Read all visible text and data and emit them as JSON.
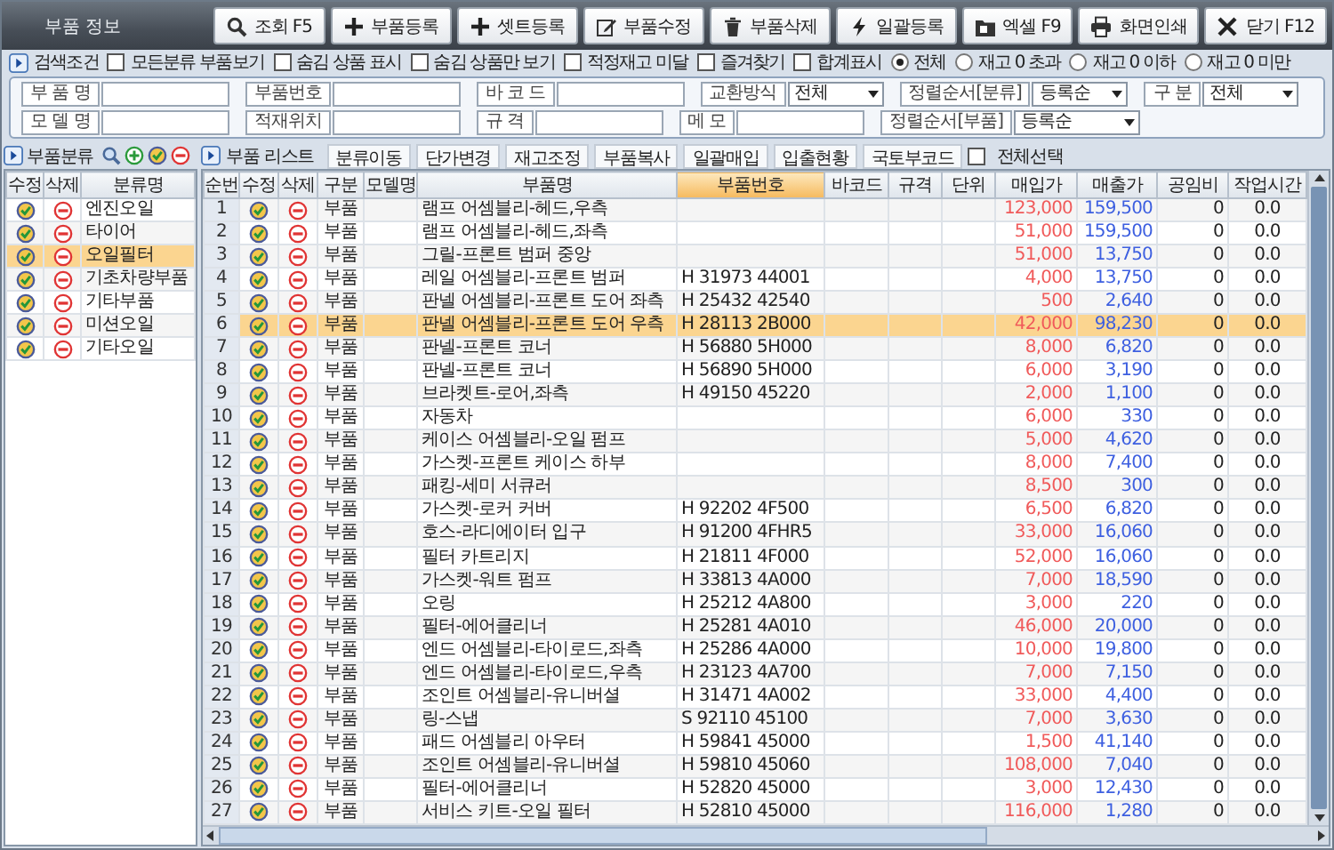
{
  "window": {
    "title": "부품 정보"
  },
  "toolbar": [
    {
      "kind": "search",
      "label": "조회 F5"
    },
    {
      "kind": "add",
      "label": "부품등록"
    },
    {
      "kind": "add",
      "label": "셋트등록"
    },
    {
      "kind": "edit",
      "label": "부품수정"
    },
    {
      "kind": "delete",
      "label": "부품삭제"
    },
    {
      "kind": "bolt",
      "label": "일괄등록"
    },
    {
      "kind": "excel",
      "label": "엑셀 F9"
    },
    {
      "kind": "print",
      "label": "화면인쇄"
    },
    {
      "kind": "close",
      "label": "닫기 F12"
    }
  ],
  "search_options": {
    "title": "검색조건",
    "checkboxes": [
      {
        "label": "모든분류 부품보기",
        "checked": false
      },
      {
        "label": "숨김 상품 표시",
        "checked": false
      },
      {
        "label": "숨김 상품만 보기",
        "checked": false
      },
      {
        "label": "적정재고 미달",
        "checked": false
      },
      {
        "label": "즐겨찾기",
        "checked": false
      },
      {
        "label": "합계표시",
        "checked": false
      }
    ],
    "radios": [
      {
        "label": "전체",
        "selected": true
      },
      {
        "label": "재고 0 초과",
        "selected": false
      },
      {
        "label": "재고 0 이하",
        "selected": false
      },
      {
        "label": "재고 0 미만",
        "selected": false
      }
    ]
  },
  "filters": [
    [
      {
        "kind": "text",
        "label": "부 품 명"
      },
      {
        "kind": "text",
        "label": "부품번호"
      },
      {
        "kind": "text",
        "label": "바 코 드"
      },
      {
        "kind": "select",
        "label": "교환방식",
        "value": "전체"
      },
      {
        "kind": "select",
        "label": "정렬순서[분류]",
        "value": "등록순"
      },
      {
        "kind": "select",
        "label": "구 분",
        "value": "전체"
      }
    ],
    [
      {
        "kind": "text",
        "label": "모 델 명"
      },
      {
        "kind": "text",
        "label": "적재위치"
      },
      {
        "kind": "text",
        "label": "규 격"
      },
      {
        "kind": "text",
        "label": "메 모"
      },
      {
        "kind": "select",
        "label": "정렬순서[부품]",
        "value": "등록순"
      }
    ]
  ],
  "category_panel": {
    "title": "부품분류",
    "columns": [
      "수정",
      "삭제",
      "분류명"
    ],
    "rows": [
      {
        "name": "엔진오일",
        "selected": false
      },
      {
        "name": "타이어",
        "selected": false
      },
      {
        "name": "오일필터",
        "selected": true
      },
      {
        "name": "기초차량부품",
        "selected": false
      },
      {
        "name": "기타부품",
        "selected": false
      },
      {
        "name": "미션오일",
        "selected": false
      },
      {
        "name": "기타오일",
        "selected": false
      }
    ]
  },
  "parts_panel": {
    "title": "부품 리스트",
    "actions": [
      "분류이동",
      "단가변경",
      "재고조정",
      "부품복사",
      "일괄매입",
      "입출현황",
      "국토부코드"
    ],
    "select_all": {
      "label": "전체선택",
      "checked": false
    },
    "columns": [
      {
        "label": "순번",
        "sorted": false
      },
      {
        "label": "수정",
        "sorted": false
      },
      {
        "label": "삭제",
        "sorted": false
      },
      {
        "label": "구분",
        "sorted": false
      },
      {
        "label": "모델명",
        "sorted": false
      },
      {
        "label": "부품명",
        "sorted": false
      },
      {
        "label": "부품번호",
        "sorted": true
      },
      {
        "label": "바코드",
        "sorted": false
      },
      {
        "label": "규격",
        "sorted": false
      },
      {
        "label": "단위",
        "sorted": false
      },
      {
        "label": "매입가",
        "sorted": false
      },
      {
        "label": "매출가",
        "sorted": false
      },
      {
        "label": "공임비",
        "sorted": false
      },
      {
        "label": "작업시간",
        "sorted": false
      }
    ],
    "rows": [
      {
        "no": "1",
        "type": "부품",
        "name": "램프 어셈블리-헤드,우측",
        "buy": "123,000",
        "sell": "159,500",
        "labor": "0",
        "time": "0.0",
        "selected": false
      },
      {
        "no": "2",
        "type": "부품",
        "name": "램프 어셈블리-헤드,좌측",
        "buy": "51,000",
        "sell": "159,500",
        "labor": "0",
        "time": "0.0",
        "selected": false
      },
      {
        "no": "3",
        "type": "부품",
        "name": "그릴-프론트 범퍼 중앙",
        "buy": "51,000",
        "sell": "13,750",
        "labor": "0",
        "time": "0.0",
        "selected": false
      },
      {
        "no": "4",
        "type": "부품",
        "name": "레일 어셈블리-프론트 범퍼",
        "part_no": "H 31973 44001",
        "buy": "4,000",
        "sell": "13,750",
        "labor": "0",
        "time": "0.0",
        "selected": false
      },
      {
        "no": "5",
        "type": "부품",
        "name": "판넬 어셈블리-프론트 도어 좌측",
        "part_no": "H 25432 42540",
        "buy": "500",
        "sell": "2,640",
        "labor": "0",
        "time": "0.0",
        "selected": false
      },
      {
        "no": "6",
        "type": "부품",
        "name": "판넬 어셈블리-프론트 도어 우측",
        "part_no": "H 28113 2B000",
        "buy": "42,000",
        "sell": "98,230",
        "labor": "0",
        "time": "0.0",
        "selected": true
      },
      {
        "no": "7",
        "type": "부품",
        "name": "판넬-프론트 코너",
        "part_no": "H 56880 5H000",
        "buy": "8,000",
        "sell": "6,820",
        "labor": "0",
        "time": "0.0",
        "selected": false
      },
      {
        "no": "8",
        "type": "부품",
        "name": "판넬-프론트 코너",
        "part_no": "H 56890 5H000",
        "buy": "6,000",
        "sell": "3,190",
        "labor": "0",
        "time": "0.0",
        "selected": false
      },
      {
        "no": "9",
        "type": "부품",
        "name": "브라켓트-로어,좌측",
        "part_no": "H 49150 45220",
        "buy": "2,000",
        "sell": "1,100",
        "labor": "0",
        "time": "0.0",
        "selected": false
      },
      {
        "no": "10",
        "type": "부품",
        "name": "자동차",
        "buy": "6,000",
        "sell": "330",
        "labor": "0",
        "time": "0.0",
        "selected": false
      },
      {
        "no": "11",
        "type": "부품",
        "name": "케이스 어셈블리-오일 펌프",
        "buy": "5,000",
        "sell": "4,620",
        "labor": "0",
        "time": "0.0",
        "selected": false
      },
      {
        "no": "12",
        "type": "부품",
        "name": "가스켓-프론트 케이스 하부",
        "buy": "8,000",
        "sell": "7,400",
        "labor": "0",
        "time": "0.0",
        "selected": false
      },
      {
        "no": "13",
        "type": "부품",
        "name": "패킹-세미 서큐러",
        "buy": "8,500",
        "sell": "300",
        "labor": "0",
        "time": "0.0",
        "selected": false
      },
      {
        "no": "14",
        "type": "부품",
        "name": "가스켓-로커 커버",
        "part_no": "H 92202 4F500",
        "buy": "6,500",
        "sell": "6,820",
        "labor": "0",
        "time": "0.0",
        "selected": false
      },
      {
        "no": "15",
        "type": "부품",
        "name": "호스-라디에이터 입구",
        "part_no": "H 91200 4FHR5",
        "buy": "33,000",
        "sell": "16,060",
        "labor": "0",
        "time": "0.0",
        "selected": false
      },
      {
        "no": "16",
        "type": "부품",
        "name": "필터 카트리지",
        "part_no": "H 21811 4F000",
        "buy": "52,000",
        "sell": "16,060",
        "labor": "0",
        "time": "0.0",
        "selected": false
      },
      {
        "no": "17",
        "type": "부품",
        "name": "가스켓-워트 펌프",
        "part_no": "H 33813 4A000",
        "buy": "7,000",
        "sell": "18,590",
        "labor": "0",
        "time": "0.0",
        "selected": false
      },
      {
        "no": "18",
        "type": "부품",
        "name": "오링",
        "part_no": "H 25212 4A800",
        "buy": "3,000",
        "sell": "220",
        "labor": "0",
        "time": "0.0",
        "selected": false
      },
      {
        "no": "19",
        "type": "부품",
        "name": "필터-에어클리너",
        "part_no": "H 25281 4A010",
        "buy": "46,000",
        "sell": "20,000",
        "labor": "0",
        "time": "0.0",
        "selected": false
      },
      {
        "no": "20",
        "type": "부품",
        "name": "엔드 어셈블리-타이로드,좌측",
        "part_no": "H 25286 4A000",
        "buy": "10,000",
        "sell": "19,800",
        "labor": "0",
        "time": "0.0",
        "selected": false
      },
      {
        "no": "21",
        "type": "부품",
        "name": "엔드 어셈블리-타이로드,우측",
        "part_no": "H 23123 4A700",
        "buy": "7,000",
        "sell": "7,150",
        "labor": "0",
        "time": "0.0",
        "selected": false
      },
      {
        "no": "22",
        "type": "부품",
        "name": "조인트 어셈블리-유니버셜",
        "part_no": "H 31471 4A002",
        "buy": "33,000",
        "sell": "4,400",
        "labor": "0",
        "time": "0.0",
        "selected": false
      },
      {
        "no": "23",
        "type": "부품",
        "name": "링-스냅",
        "part_no": "S 92110 45100",
        "buy": "7,000",
        "sell": "3,630",
        "labor": "0",
        "time": "0.0",
        "selected": false
      },
      {
        "no": "24",
        "type": "부품",
        "name": "패드 어셈블리 아우터",
        "part_no": "H 59841 45000",
        "buy": "1,500",
        "sell": "41,140",
        "labor": "0",
        "time": "0.0",
        "selected": false
      },
      {
        "no": "25",
        "type": "부품",
        "name": "조인트 어셈블리-유니버셜",
        "part_no": "H 59810 45060",
        "buy": "108,000",
        "sell": "7,040",
        "labor": "0",
        "time": "0.0",
        "selected": false
      },
      {
        "no": "26",
        "type": "부품",
        "name": "필터-에어클리너",
        "part_no": "H 52820 45000",
        "buy": "3,000",
        "sell": "12,430",
        "labor": "0",
        "time": "0.0",
        "selected": false
      },
      {
        "no": "27",
        "type": "부품",
        "name": "서비스 키트-오일 필터",
        "part_no": "H 52810 45000",
        "buy": "116,000",
        "sell": "1,280",
        "labor": "0",
        "time": "0.0",
        "selected": false
      }
    ]
  }
}
